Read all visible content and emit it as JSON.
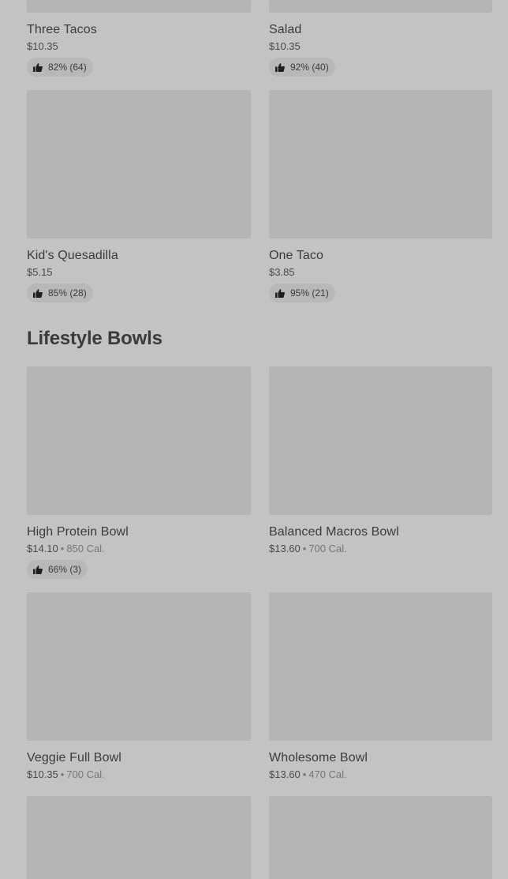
{
  "top_row": [
    {
      "name": "Three Tacos",
      "price": "$10.35",
      "rating": "82% (64)"
    },
    {
      "name": "Salad",
      "price": "$10.35",
      "rating": "92% (40)"
    }
  ],
  "second_row": [
    {
      "name": "Kid's Quesadilla",
      "price": "$5.15",
      "rating": "85% (28)"
    },
    {
      "name": "One Taco",
      "price": "$3.85",
      "rating": "95% (21)"
    }
  ],
  "section": {
    "title": "Lifestyle Bowls"
  },
  "bowls": [
    {
      "name": "High Protein Bowl",
      "price": "$14.10",
      "sep": "•",
      "calories": "850 Cal.",
      "rating": "66% (3)"
    },
    {
      "name": "Balanced Macros Bowl",
      "price": "$13.60",
      "sep": "•",
      "calories": "700 Cal."
    },
    {
      "name": "Veggie Full Bowl",
      "price": "$10.35",
      "sep": "•",
      "calories": "700 Cal."
    },
    {
      "name": "Wholesome Bowl",
      "price": "$13.60",
      "sep": "•",
      "calories": "470 Cal."
    }
  ],
  "icons": {
    "rating": "thumbs-up-icon"
  },
  "colors": {
    "background": "#c3c3c3",
    "image_placeholder": "#b5b5b5",
    "badge": "#b8b8b8",
    "text": "#3b3b3b",
    "muted": "#767676"
  }
}
